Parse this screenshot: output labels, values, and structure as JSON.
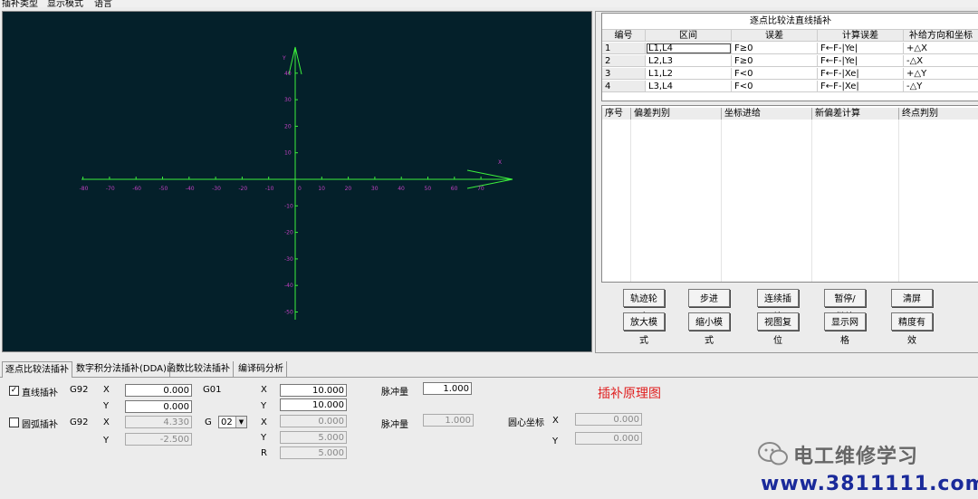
{
  "menu": [
    "插补类型",
    "显示模式",
    "语言"
  ],
  "canvas": {
    "x_label": "X",
    "y_label": "Y",
    "x_ticks": [
      "-80",
      "-70",
      "-60",
      "-50",
      "-40",
      "-30",
      "-20",
      "-10",
      "0",
      "10",
      "20",
      "30",
      "40",
      "50",
      "60",
      "70"
    ],
    "y_ticks": [
      "40",
      "30",
      "20",
      "10",
      "-10",
      "-20",
      "-30",
      "-40",
      "-50"
    ],
    "bg_color": "#04202a",
    "axis_color": "#3cf03c",
    "tick_label_color": "#c040c0"
  },
  "grid1": {
    "title": "逐点比较法直线插补",
    "headers": [
      "编号",
      "区间",
      "误差",
      "计算误差",
      "补给方向和坐标"
    ],
    "rows": [
      [
        "1",
        "L1,L4",
        "F≥0",
        "F←F-|Ye|",
        "+△X"
      ],
      [
        "2",
        "L2,L3",
        "F≥0",
        "F←F-|Ye|",
        "-△X"
      ],
      [
        "3",
        "L1,L2",
        "F<0",
        "F←F-|Xe|",
        "+△Y"
      ],
      [
        "4",
        "L3,L4",
        "F<0",
        "F←F-|Xe|",
        "-△Y"
      ]
    ]
  },
  "grid2": {
    "headers": [
      "序号",
      "偏差判别",
      "坐标进给",
      "新偏差计算",
      "终点判别"
    ]
  },
  "buttons": {
    "row1": [
      "轨迹轮廓",
      "步进",
      "连续插补",
      "暂停/继续",
      "清屏"
    ],
    "row2": [
      "放大模式",
      "缩小模式",
      "视图复位",
      "显示网格",
      "精度有效"
    ]
  },
  "tabs": [
    "逐点比较法插补",
    "数字积分法插补(DDA)",
    "函数比较法插补",
    "编译码分析"
  ],
  "form": {
    "line": {
      "label": "直线插补",
      "checked": true,
      "g": "G92",
      "x_label": "X",
      "x_value": "0.000",
      "y_label": "Y",
      "y_value": "0.000",
      "g2": "G01",
      "x2_label": "X",
      "x2_value": "10.000",
      "y2_label": "Y",
      "y2_value": "10.000",
      "pulse_label": "脉冲量",
      "pulse_value": "1.000"
    },
    "arc": {
      "label": "圆弧插补",
      "checked": false,
      "g": "G92",
      "x_label": "X",
      "x_value": "4.330",
      "y_label": "Y",
      "y_value": "-2.500",
      "g_label": "G",
      "g_select": "02",
      "x2_label": "X",
      "x2_value": "0.000",
      "y2_label": "Y",
      "y2_value": "5.000",
      "r_label": "R",
      "r_value": "5.000",
      "pulse_label": "脉冲量",
      "pulse_value": "1.000",
      "center_label": "圆心坐标",
      "cx_label": "X",
      "cx_value": "0.000",
      "cy_label": "Y",
      "cy_value": "0.000"
    }
  },
  "principle": "插补原理图",
  "watermark": {
    "text": "电工维修学习",
    "url": "www.3811111.com"
  }
}
